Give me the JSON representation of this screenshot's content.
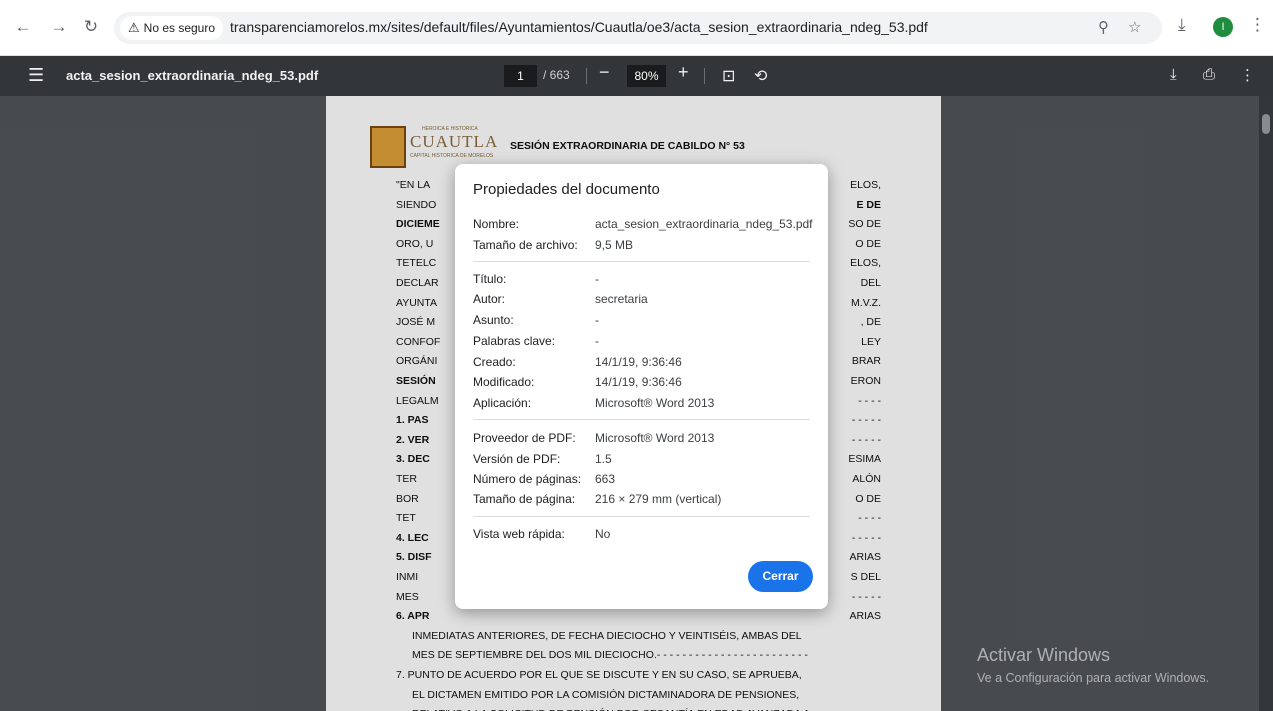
{
  "browser": {
    "security_label": "No es seguro",
    "url": "transparenciamorelos.mx/sites/default/files/Ayuntamientos/Cuautla/oe3/acta_sesion_extraordinaria_ndeg_53.pdf",
    "profile_initial": "I"
  },
  "viewer": {
    "title": "acta_sesion_extraordinaria_ndeg_53.pdf",
    "page_current": "1",
    "page_total": "/ 663",
    "zoom": "80%"
  },
  "document": {
    "logo_top": "HEROICA E HISTORICA",
    "logo_main": "CUAUTLA",
    "logo_sub": "CAPITAL HISTORICA DE MORELOS",
    "heading": "SESIÓN EXTRAORDINARIA DE CABILDO N° 53",
    "left_lines": [
      "\"EN LA",
      "SIENDO",
      "DICIEME",
      "ORO, U",
      "TETELC",
      "DECLAR",
      "AYUNTA",
      "JOSÉ M",
      "CONFOF",
      "ORGÁNI",
      "SESIÓN",
      "LEGALM",
      "1. PAS",
      "2. VER",
      "3. DEC",
      "TER",
      "BOR",
      "TET",
      "4. LEC",
      "5. DISF",
      "INMI",
      "MES",
      "6. APR"
    ],
    "right_lines": [
      "ELOS,",
      "E DE",
      "SO DE",
      "O DE",
      "ELOS,",
      "DEL",
      "M.V.Z.",
      ", DE",
      "LEY",
      "BRAR",
      "ERON",
      "- - - -",
      "- - - - -",
      "- - - - -",
      "ESIMA",
      "ALÓN",
      "O DE",
      "- - - -",
      "- - - - -",
      "ARIAS",
      "S DEL",
      "- - - - -",
      "ARIAS"
    ],
    "full_lines": [
      "INMEDIATAS ANTERIORES, DE FECHA DIECIOCHO Y VEINTISÉIS, AMBAS DEL",
      "MES DE SEPTIEMBRE DEL DOS MIL DIECIOCHO.- - - - - - - - - - - - - - - - - - - - - - - -",
      "7. PUNTO DE ACUERDO POR EL QUE SE DISCUTE Y EN SU CASO, SE APRUEBA,",
      "EL DICTAMEN EMITIDO POR LA COMISIÓN DICTAMINADORA DE PENSIONES,",
      "RELATIVO A LA SOLICITUD DE PENSIÓN POR CESANTÍA EN EDAD AVANZADA A"
    ]
  },
  "dialog": {
    "title": "Propiedades del documento",
    "close_label": "Cerrar",
    "props": [
      {
        "label": "Nombre:",
        "value": "acta_sesion_extraordinaria_ndeg_53.pdf"
      },
      {
        "label": "Tamaño de archivo:",
        "value": "9,5 MB"
      },
      {
        "label": "Título:",
        "value": "-"
      },
      {
        "label": "Autor:",
        "value": "secretaria"
      },
      {
        "label": "Asunto:",
        "value": "-"
      },
      {
        "label": "Palabras clave:",
        "value": "-"
      },
      {
        "label": "Creado:",
        "value": "14/1/19, 9:36:46"
      },
      {
        "label": "Modificado:",
        "value": "14/1/19, 9:36:46"
      },
      {
        "label": "Aplicación:",
        "value": "Microsoft® Word 2013"
      },
      {
        "label": "Proveedor de PDF:",
        "value": "Microsoft® Word 2013"
      },
      {
        "label": "Versión de PDF:",
        "value": "1.5"
      },
      {
        "label": "Número de páginas:",
        "value": "663"
      },
      {
        "label": "Tamaño de página:",
        "value": "216 × 279 mm (vertical)"
      },
      {
        "label": "Vista web rápida:",
        "value": "No"
      }
    ]
  },
  "watermark": {
    "title": "Activar Windows",
    "subtitle": "Ve a Configuración para activar Windows."
  }
}
